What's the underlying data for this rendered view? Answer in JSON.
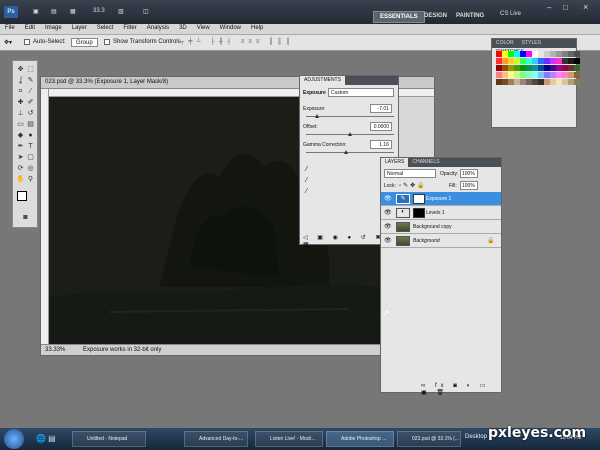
{
  "app": {
    "logo": "Ps",
    "zoom": "33.3",
    "workspaces": [
      "ESSENTIALS",
      "DESIGN",
      "PAINTING"
    ],
    "cs_live": "CS Live"
  },
  "menu": [
    "File",
    "Edit",
    "Image",
    "Layer",
    "Select",
    "Filter",
    "Analysis",
    "3D",
    "View",
    "Window",
    "Help"
  ],
  "options": {
    "auto_select_label": "Auto-Select:",
    "auto_select_value": "Group",
    "transform_label": "Show Transform Controls"
  },
  "document": {
    "title": "023.psd @ 33.3% (Exposure 1, Layer Mask/8)",
    "zoom": "33.33%",
    "status": "Exposure works in 32-bit only"
  },
  "swatches_panel": {
    "tabs": [
      "COLOR",
      "STYLES",
      "SWATCHES"
    ],
    "colors": [
      "#ff0000",
      "#ffff00",
      "#00ff00",
      "#00ffff",
      "#0000ff",
      "#ff00ff",
      "#ffffff",
      "#e6e6e6",
      "#cccccc",
      "#b3b3b3",
      "#999999",
      "#808080",
      "#666666",
      "#4d4d4d",
      "#ff3333",
      "#ff9933",
      "#ffcc33",
      "#ccff33",
      "#33ff66",
      "#33ffcc",
      "#33ccff",
      "#3366ff",
      "#6633ff",
      "#cc33ff",
      "#ff33cc",
      "#333333",
      "#1a1a1a",
      "#000000",
      "#990000",
      "#994c00",
      "#999900",
      "#4c9900",
      "#009900",
      "#00994c",
      "#009999",
      "#004c99",
      "#000099",
      "#4c0099",
      "#990099",
      "#99004c",
      "#663333",
      "#336633",
      "#ff8080",
      "#ffbf80",
      "#ffff80",
      "#bfff80",
      "#80ff80",
      "#80ffbf",
      "#80ffff",
      "#80bfff",
      "#8080ff",
      "#bf80ff",
      "#ff80ff",
      "#ff80bf",
      "#c69c6d",
      "#8c6239",
      "#603913",
      "#754c24",
      "#a67c52",
      "#c7b299",
      "#998675",
      "#736357",
      "#534741",
      "#362f2d",
      "#c69c6e",
      "#e0c9a6",
      "#f7e4b5",
      "#d9c59c",
      "#b39c78",
      "#8c7a5c"
    ]
  },
  "adjustments": {
    "tab": "ADJUSTMENTS",
    "type_label": "Exposure",
    "preset_value": "Custom",
    "exposure_label": "Exposure:",
    "exposure_value": "-7.01",
    "offset_label": "Offset:",
    "offset_value": "0.0000",
    "gamma_label": "Gamma Correction:",
    "gamma_value": "1.16",
    "exposure_level": 0.12,
    "offset_level": 0.5,
    "gamma_level": 0.45
  },
  "layers": {
    "tabs": [
      "LAYERS",
      "CHANNELS"
    ],
    "blend_mode": "Normal",
    "opacity_label": "Opacity:",
    "opacity_value": "100%",
    "lock_label": "Lock:",
    "fill_label": "Fill:",
    "fill_value": "100%",
    "rows": [
      {
        "name": "Exposure 1",
        "selected": true
      },
      {
        "name": "Levels 1",
        "selected": false
      },
      {
        "name": "Background copy",
        "selected": false
      },
      {
        "name": "Background",
        "selected": false
      }
    ]
  },
  "taskbar": {
    "buttons": [
      "Untitled - Notepad",
      "Advanced Day-to-...",
      "Listen Live! - Mozil...",
      "Adobe Photoshop ...",
      "023.psd @ 33.1% (...",
      "Desktop"
    ],
    "clock": "10:04 PM"
  },
  "watermark": "pxleyes.com"
}
